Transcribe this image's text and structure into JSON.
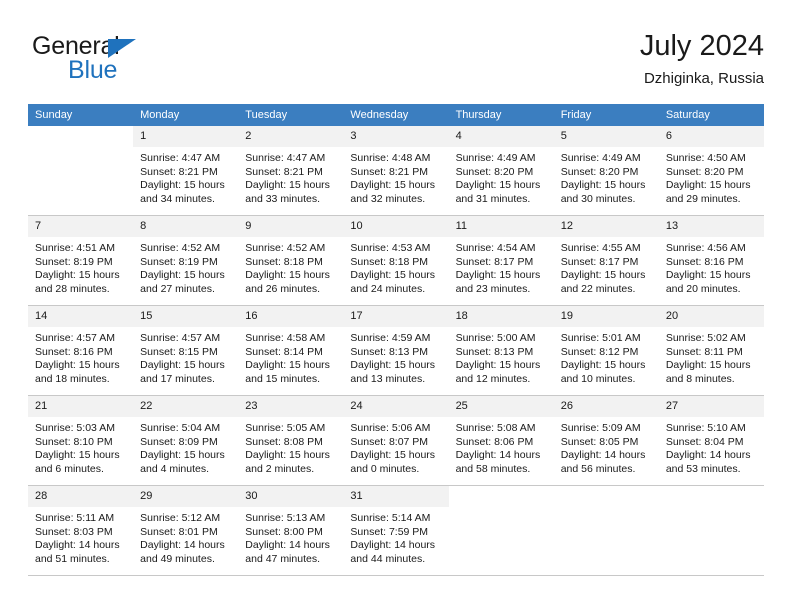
{
  "brand": {
    "word_one": "General",
    "word_two": "Blue",
    "triangle_color": "#1f72bd"
  },
  "header": {
    "title": "July 2024",
    "location": "Dzhiginka, Russia"
  },
  "theme": {
    "header_blue": "#3b7ec0",
    "daynum_band": "#f2f2f2",
    "grid_line": "#c8c8c8",
    "text": "#1a1a1a"
  },
  "weekday_headers": [
    "Sunday",
    "Monday",
    "Tuesday",
    "Wednesday",
    "Thursday",
    "Friday",
    "Saturday"
  ],
  "weeks": [
    [
      {
        "day": "",
        "blank": true,
        "sunrise": "",
        "sunset": "",
        "daylight_line1": "",
        "daylight_line2": ""
      },
      {
        "day": "1",
        "sunrise": "Sunrise: 4:47 AM",
        "sunset": "Sunset: 8:21 PM",
        "daylight_line1": "Daylight: 15 hours",
        "daylight_line2": "and 34 minutes."
      },
      {
        "day": "2",
        "sunrise": "Sunrise: 4:47 AM",
        "sunset": "Sunset: 8:21 PM",
        "daylight_line1": "Daylight: 15 hours",
        "daylight_line2": "and 33 minutes."
      },
      {
        "day": "3",
        "sunrise": "Sunrise: 4:48 AM",
        "sunset": "Sunset: 8:21 PM",
        "daylight_line1": "Daylight: 15 hours",
        "daylight_line2": "and 32 minutes."
      },
      {
        "day": "4",
        "sunrise": "Sunrise: 4:49 AM",
        "sunset": "Sunset: 8:20 PM",
        "daylight_line1": "Daylight: 15 hours",
        "daylight_line2": "and 31 minutes."
      },
      {
        "day": "5",
        "sunrise": "Sunrise: 4:49 AM",
        "sunset": "Sunset: 8:20 PM",
        "daylight_line1": "Daylight: 15 hours",
        "daylight_line2": "and 30 minutes."
      },
      {
        "day": "6",
        "sunrise": "Sunrise: 4:50 AM",
        "sunset": "Sunset: 8:20 PM",
        "daylight_line1": "Daylight: 15 hours",
        "daylight_line2": "and 29 minutes."
      }
    ],
    [
      {
        "day": "7",
        "sunrise": "Sunrise: 4:51 AM",
        "sunset": "Sunset: 8:19 PM",
        "daylight_line1": "Daylight: 15 hours",
        "daylight_line2": "and 28 minutes."
      },
      {
        "day": "8",
        "sunrise": "Sunrise: 4:52 AM",
        "sunset": "Sunset: 8:19 PM",
        "daylight_line1": "Daylight: 15 hours",
        "daylight_line2": "and 27 minutes."
      },
      {
        "day": "9",
        "sunrise": "Sunrise: 4:52 AM",
        "sunset": "Sunset: 8:18 PM",
        "daylight_line1": "Daylight: 15 hours",
        "daylight_line2": "and 26 minutes."
      },
      {
        "day": "10",
        "sunrise": "Sunrise: 4:53 AM",
        "sunset": "Sunset: 8:18 PM",
        "daylight_line1": "Daylight: 15 hours",
        "daylight_line2": "and 24 minutes."
      },
      {
        "day": "11",
        "sunrise": "Sunrise: 4:54 AM",
        "sunset": "Sunset: 8:17 PM",
        "daylight_line1": "Daylight: 15 hours",
        "daylight_line2": "and 23 minutes."
      },
      {
        "day": "12",
        "sunrise": "Sunrise: 4:55 AM",
        "sunset": "Sunset: 8:17 PM",
        "daylight_line1": "Daylight: 15 hours",
        "daylight_line2": "and 22 minutes."
      },
      {
        "day": "13",
        "sunrise": "Sunrise: 4:56 AM",
        "sunset": "Sunset: 8:16 PM",
        "daylight_line1": "Daylight: 15 hours",
        "daylight_line2": "and 20 minutes."
      }
    ],
    [
      {
        "day": "14",
        "sunrise": "Sunrise: 4:57 AM",
        "sunset": "Sunset: 8:16 PM",
        "daylight_line1": "Daylight: 15 hours",
        "daylight_line2": "and 18 minutes."
      },
      {
        "day": "15",
        "sunrise": "Sunrise: 4:57 AM",
        "sunset": "Sunset: 8:15 PM",
        "daylight_line1": "Daylight: 15 hours",
        "daylight_line2": "and 17 minutes."
      },
      {
        "day": "16",
        "sunrise": "Sunrise: 4:58 AM",
        "sunset": "Sunset: 8:14 PM",
        "daylight_line1": "Daylight: 15 hours",
        "daylight_line2": "and 15 minutes."
      },
      {
        "day": "17",
        "sunrise": "Sunrise: 4:59 AM",
        "sunset": "Sunset: 8:13 PM",
        "daylight_line1": "Daylight: 15 hours",
        "daylight_line2": "and 13 minutes."
      },
      {
        "day": "18",
        "sunrise": "Sunrise: 5:00 AM",
        "sunset": "Sunset: 8:13 PM",
        "daylight_line1": "Daylight: 15 hours",
        "daylight_line2": "and 12 minutes."
      },
      {
        "day": "19",
        "sunrise": "Sunrise: 5:01 AM",
        "sunset": "Sunset: 8:12 PM",
        "daylight_line1": "Daylight: 15 hours",
        "daylight_line2": "and 10 minutes."
      },
      {
        "day": "20",
        "sunrise": "Sunrise: 5:02 AM",
        "sunset": "Sunset: 8:11 PM",
        "daylight_line1": "Daylight: 15 hours",
        "daylight_line2": "and 8 minutes."
      }
    ],
    [
      {
        "day": "21",
        "sunrise": "Sunrise: 5:03 AM",
        "sunset": "Sunset: 8:10 PM",
        "daylight_line1": "Daylight: 15 hours",
        "daylight_line2": "and 6 minutes."
      },
      {
        "day": "22",
        "sunrise": "Sunrise: 5:04 AM",
        "sunset": "Sunset: 8:09 PM",
        "daylight_line1": "Daylight: 15 hours",
        "daylight_line2": "and 4 minutes."
      },
      {
        "day": "23",
        "sunrise": "Sunrise: 5:05 AM",
        "sunset": "Sunset: 8:08 PM",
        "daylight_line1": "Daylight: 15 hours",
        "daylight_line2": "and 2 minutes."
      },
      {
        "day": "24",
        "sunrise": "Sunrise: 5:06 AM",
        "sunset": "Sunset: 8:07 PM",
        "daylight_line1": "Daylight: 15 hours",
        "daylight_line2": "and 0 minutes."
      },
      {
        "day": "25",
        "sunrise": "Sunrise: 5:08 AM",
        "sunset": "Sunset: 8:06 PM",
        "daylight_line1": "Daylight: 14 hours",
        "daylight_line2": "and 58 minutes."
      },
      {
        "day": "26",
        "sunrise": "Sunrise: 5:09 AM",
        "sunset": "Sunset: 8:05 PM",
        "daylight_line1": "Daylight: 14 hours",
        "daylight_line2": "and 56 minutes."
      },
      {
        "day": "27",
        "sunrise": "Sunrise: 5:10 AM",
        "sunset": "Sunset: 8:04 PM",
        "daylight_line1": "Daylight: 14 hours",
        "daylight_line2": "and 53 minutes."
      }
    ],
    [
      {
        "day": "28",
        "sunrise": "Sunrise: 5:11 AM",
        "sunset": "Sunset: 8:03 PM",
        "daylight_line1": "Daylight: 14 hours",
        "daylight_line2": "and 51 minutes."
      },
      {
        "day": "29",
        "sunrise": "Sunrise: 5:12 AM",
        "sunset": "Sunset: 8:01 PM",
        "daylight_line1": "Daylight: 14 hours",
        "daylight_line2": "and 49 minutes."
      },
      {
        "day": "30",
        "sunrise": "Sunrise: 5:13 AM",
        "sunset": "Sunset: 8:00 PM",
        "daylight_line1": "Daylight: 14 hours",
        "daylight_line2": "and 47 minutes."
      },
      {
        "day": "31",
        "sunrise": "Sunrise: 5:14 AM",
        "sunset": "Sunset: 7:59 PM",
        "daylight_line1": "Daylight: 14 hours",
        "daylight_line2": "and 44 minutes."
      },
      {
        "day": "",
        "blank": true,
        "sunrise": "",
        "sunset": "",
        "daylight_line1": "",
        "daylight_line2": ""
      },
      {
        "day": "",
        "blank": true,
        "sunrise": "",
        "sunset": "",
        "daylight_line1": "",
        "daylight_line2": ""
      },
      {
        "day": "",
        "blank": true,
        "sunrise": "",
        "sunset": "",
        "daylight_line1": "",
        "daylight_line2": ""
      }
    ]
  ]
}
